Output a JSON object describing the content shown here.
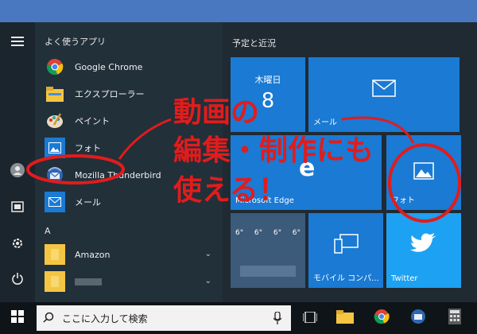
{
  "start_menu": {
    "frequent_header": "よく使うアプリ",
    "frequent_apps": [
      {
        "label": "Google Chrome",
        "icon": "chrome-icon"
      },
      {
        "label": "エクスプローラー",
        "icon": "file-explorer-icon"
      },
      {
        "label": "ペイント",
        "icon": "paint-icon"
      },
      {
        "label": "フォト",
        "icon": "photos-icon"
      },
      {
        "label": "Mozilla Thunderbird",
        "icon": "thunderbird-icon"
      },
      {
        "label": "メール",
        "icon": "mail-icon"
      }
    ],
    "alpha_header": "A",
    "alpha_apps": [
      {
        "label": "Amazon",
        "icon": "folder-icon"
      },
      {
        "label": "",
        "icon": "folder-icon"
      }
    ],
    "tiles_header": "予定と近況",
    "tiles": {
      "calendar": {
        "day": "木曜日",
        "date": "8"
      },
      "mail": {
        "label": "メール"
      },
      "edge": {
        "label": "Microsoft Edge"
      },
      "photos": {
        "label": "フォト"
      },
      "weather": {
        "days": [
          "6°",
          "6°",
          "6°",
          "6°"
        ]
      },
      "mobile": {
        "label": "モバイル コンパ..."
      },
      "twitter": {
        "label": "Twitter"
      }
    }
  },
  "taskbar": {
    "search_placeholder": "ここに入力して検索"
  },
  "annotation": {
    "line1": "動画の",
    "line2": "編集・制作にも",
    "line3": "使える！"
  },
  "colors": {
    "tile_blue": "#1a7ad4",
    "annotation_red": "#e11c1c",
    "menu_bg": "#1f2a33"
  }
}
